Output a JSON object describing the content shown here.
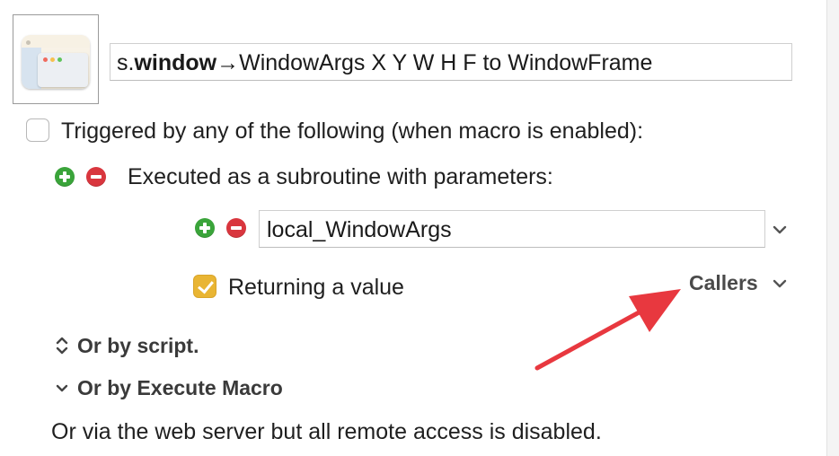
{
  "macro": {
    "title_prefix": "s.",
    "title_bold": "window",
    "title_rest": "→WindowArgs X Y W H F to WindowFrame"
  },
  "triggers": {
    "triggered_label": "Triggered by any of the following (when macro is enabled):",
    "triggered_checked": false,
    "subroutine_label": "Executed as a subroutine with parameters:",
    "parameter_value": "local_WindowArgs",
    "returning_label": "Returning a value",
    "returning_checked": true,
    "callers_label": "Callers"
  },
  "sections": {
    "by_script": "Or by script.",
    "by_execute_macro": "Or by Execute Macro",
    "web_server_note": "Or via the web server but all remote access is disabled."
  },
  "colors": {
    "add": "#3aa43a",
    "remove": "#d9363e",
    "checkbox_checked": "#e9b533",
    "annotation_arrow": "#e8383f"
  }
}
